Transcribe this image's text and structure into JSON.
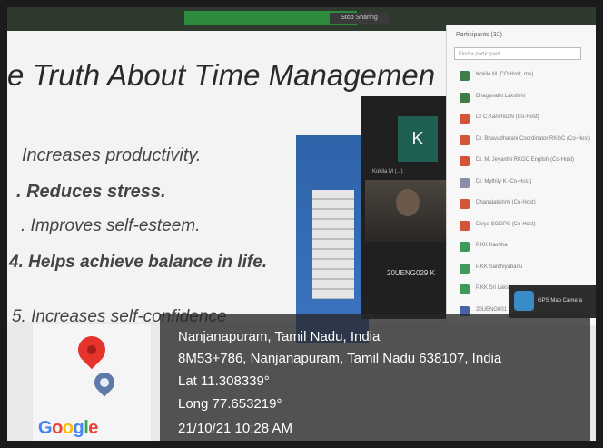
{
  "meeting": {
    "top_tab": "Stop Sharing",
    "slide": {
      "title": "e Truth About Time Managemen",
      "bullets": [
        "Increases productivity.",
        ". Reduces stress.",
        ". Improves self-esteem.",
        "4.  Helps achieve balance in life.",
        "5.  Increases self-confidence"
      ]
    },
    "video": {
      "tile_letter": "K",
      "tile_name": "Kokila M (...)",
      "camera_name": "20UENG029 K"
    },
    "participants": {
      "header": "Participants (32)",
      "search_placeholder": "Find a participant",
      "items": [
        {
          "name": "Kokila M (CO Host, me)",
          "color": "#3f7d46"
        },
        {
          "name": "Bhagavathi Lakshmi",
          "color": "#3f7d46"
        },
        {
          "name": "Dr C.Kanimozhi (Co-Host)",
          "color": "#d2553a"
        },
        {
          "name": "Dr. Bhavadharani Coordinator RKGC (Co-Host)",
          "color": "#d2553a"
        },
        {
          "name": "Dr. M. Jeyanthi RKGC English (Co-Host)",
          "color": "#d2553a"
        },
        {
          "name": "Dr. Mythily K (Co-Host)",
          "color": "#8a8fa8"
        },
        {
          "name": "Dhanalakshmi (Co-Host)",
          "color": "#d2553a"
        },
        {
          "name": "Divya SGGPS (Co-Host)",
          "color": "#d2553a"
        },
        {
          "name": "P.KK Kavitha",
          "color": "#3f9a5a"
        },
        {
          "name": "P.KK Santhiyabanu",
          "color": "#3f9a5a"
        },
        {
          "name": "P.KK Sri Lakshmi",
          "color": "#3f9a5a"
        },
        {
          "name": "20UENG001",
          "color": "#4a63a8"
        }
      ]
    },
    "gps_logo_text": "GPS Map Camera"
  },
  "gps": {
    "place": "Nanjanapuram, Tamil Nadu, India",
    "address": "8M53+786, Nanjanapuram, Tamil Nadu 638107, India",
    "lat": "Lat 11.308339°",
    "long": "Long 77.653219°",
    "datetime": "21/10/21 10:28 AM",
    "map_logo": [
      "G",
      "o",
      "o",
      "g",
      "l",
      "e"
    ],
    "map_logo_colors": [
      "#4285F4",
      "#EA4335",
      "#FBBC05",
      "#4285F4",
      "#34A853",
      "#EA4335"
    ]
  }
}
